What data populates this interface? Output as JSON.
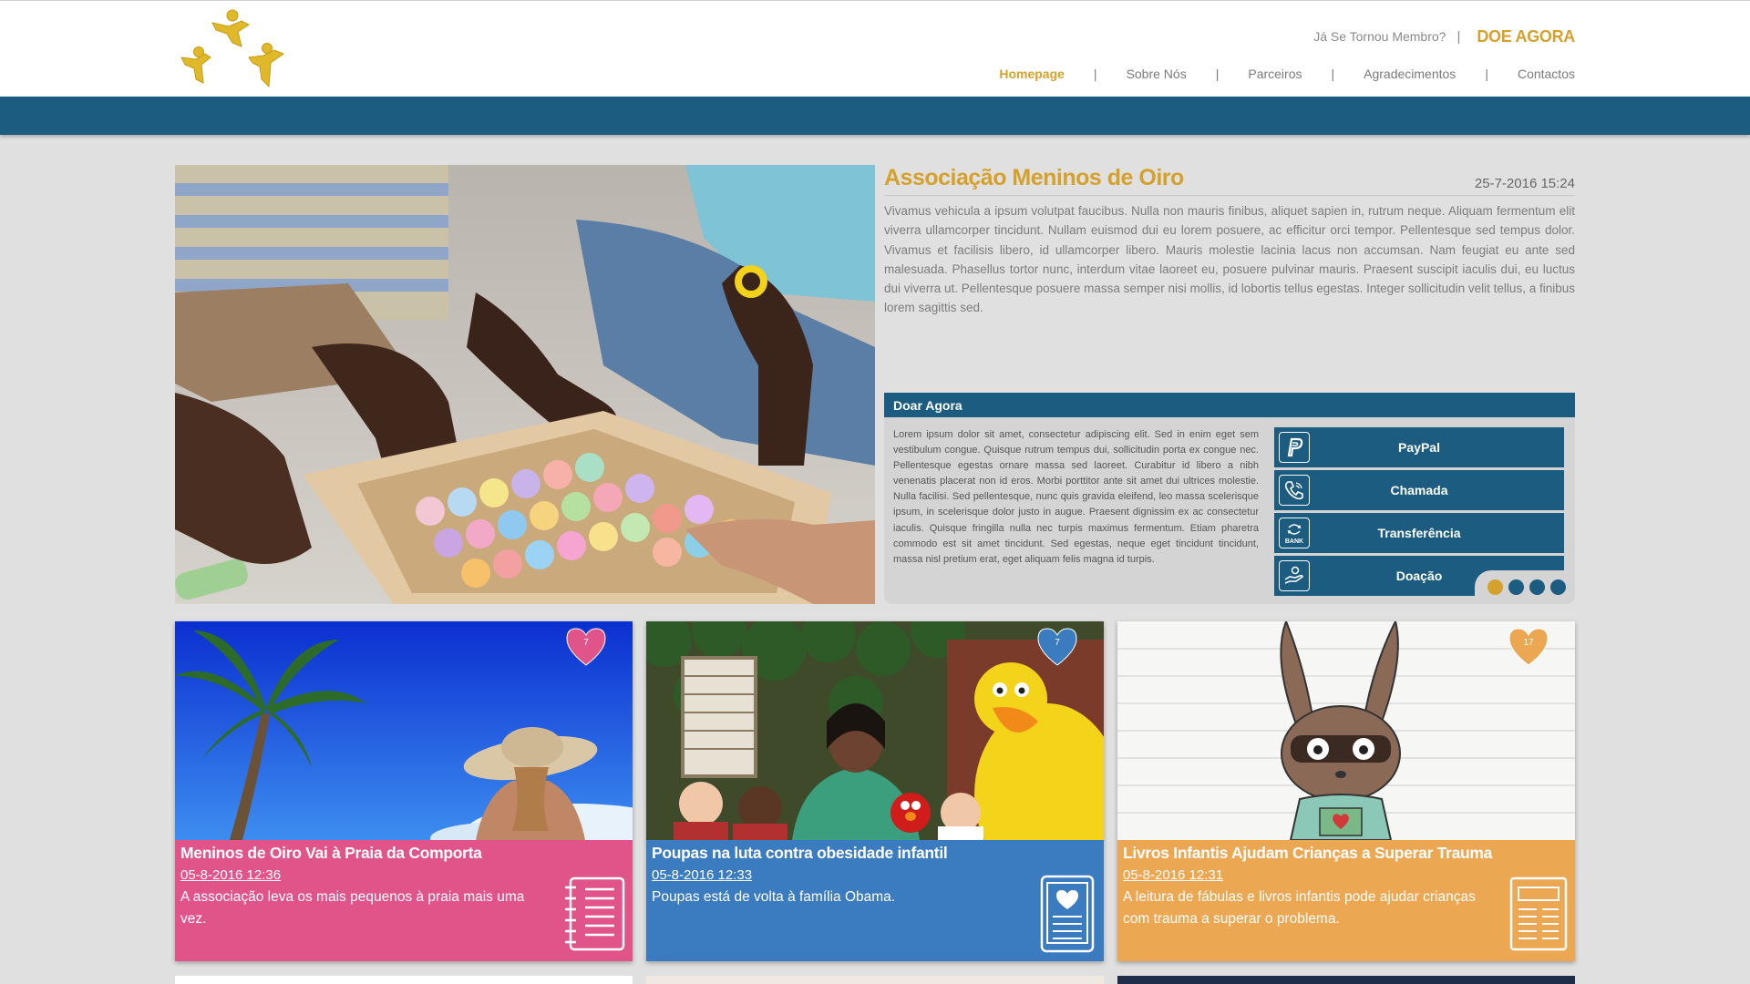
{
  "header": {
    "member_link": "Já Se Tornou Membro?",
    "separator": "|",
    "donate_now": "DOE AGORA",
    "nav": [
      {
        "label": "Homepage",
        "active": true
      },
      {
        "label": "Sobre Nós",
        "active": false
      },
      {
        "label": "Parceiros",
        "active": false
      },
      {
        "label": "Agradecimentos",
        "active": false
      },
      {
        "label": "Contactos",
        "active": false
      }
    ]
  },
  "article": {
    "title": "Associação Meninos de Oiro",
    "date": "25-7-2016 15:24",
    "body": "Vivamus vehicula a ipsum volutpat faucibus. Nulla non mauris finibus, aliquet sapien in, rutrum neque. Aliquam fermentum elit viverra ullamcorper tincidunt. Nullam euismod dui eu lorem posuere, ac efficitur orci tempor. Pellentesque sed tempus dolor. Vivamus et facilisis libero, id ullamcorper libero. Mauris molestie lacinia lacus non accumsan. Nam feugiat eu ante sed malesuada. Phasellus tortor nunc, interdum vitae laoreet eu, posuere pulvinar mauris. Praesent suscipit iaculis dui, eu luctus dui viverra ut. Pellentesque posuere massa semper nisi mollis, id lobortis tellus egestas. Integer sollicitudin velit tellus, a finibus lorem sagittis sed."
  },
  "donate": {
    "title": "Doar Agora",
    "text": "Lorem ipsum dolor sit amet, consectetur adipiscing elit. Sed in enim eget sem vestibulum congue. Quisque rutrum tempus dui, sollicitudin porta ex congue nec. Pellentesque egestas ornare massa sed laoreet. Curabitur id libero a nibh venenatis placerat non id eros. Morbi porttitor ante sit amet dui ultrices molestie. Nulla facilisi. Sed pellentesque, nunc quis gravida eleifend, leo massa scelerisque ipsum, in scelerisque dolor justo in augue. Praesent dignissim ex ac consectetur iaculis. Quisque fringilla nulla nec turpis maximus fermentum. Etiam pharetra commodo est sit amet tincidunt. Sed egestas, neque eget tincidunt tincidunt, massa nisl pretium erat, eget aliquam felis magna id turpis.",
    "methods": [
      {
        "label": "PayPal",
        "icon": "paypal-icon"
      },
      {
        "label": "Chamada",
        "icon": "phone-icon"
      },
      {
        "label": "Transferência",
        "icon": "bank-transfer-icon"
      },
      {
        "label": "Doação",
        "icon": "donation-hand-icon"
      }
    ],
    "bank_icon_text": "BANK",
    "slider_active_index": 0,
    "slider_count": 4
  },
  "cards": [
    {
      "title": "Meninos de Oiro Vai à Praia da Comporta",
      "date": "05-8-2016 12:36",
      "description": "A associação leva os mais pequenos à praia mais uma vez.",
      "likes": "7",
      "color": "#e0548a",
      "icon": "notebook-icon"
    },
    {
      "title": "Poupas na luta contra obesidade infantil",
      "date": "05-8-2016 12:33",
      "description": "Poupas está de volta à família Obama.",
      "likes": "7",
      "color": "#3b7bbf",
      "icon": "tablet-heart-icon"
    },
    {
      "title": "Livros Infantis Ajudam Crianças a Superar Trauma",
      "date": "05-8-2016 12:31",
      "description": "A leitura de fábulas e livros infantis pode ajudar crianças com trauma a superar o problema.",
      "likes": "17",
      "color": "#eca753",
      "icon": "newspaper-icon"
    }
  ],
  "colors": {
    "brand_blue": "#1b5c80",
    "gold": "#d4a12c",
    "pink": "#e0548a",
    "blue": "#3b7bbf",
    "orange": "#eca753"
  }
}
